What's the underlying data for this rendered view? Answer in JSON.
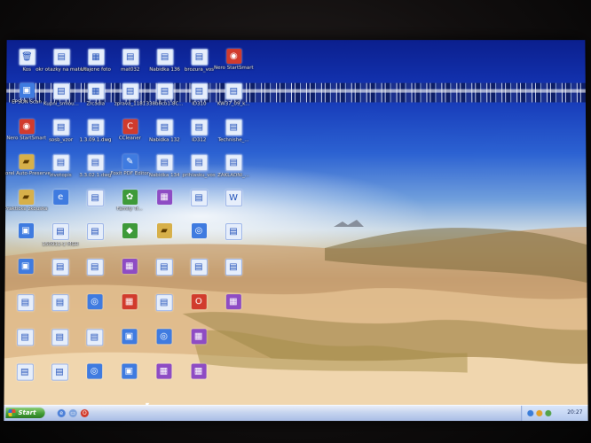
{
  "desktop": {
    "icons": [
      {
        "label": "Kos",
        "kind": "doc",
        "glyph": "🗑",
        "col": 0,
        "row": 0
      },
      {
        "label": "okr otazky na maturitu",
        "kind": "doc",
        "glyph": "▤",
        "col": 1,
        "row": 0
      },
      {
        "label": "Utajene foto",
        "kind": "doc",
        "glyph": "▦",
        "col": 2,
        "row": 0
      },
      {
        "label": "mat032",
        "kind": "doc",
        "glyph": "▤",
        "col": 3,
        "row": 0
      },
      {
        "label": "Nabidka 136",
        "kind": "doc",
        "glyph": "▤",
        "col": 4,
        "row": 0
      },
      {
        "label": "brozura_vos",
        "kind": "doc",
        "glyph": "▤",
        "col": 5,
        "row": 0
      },
      {
        "label": "Nero StartSmart",
        "kind": "red",
        "glyph": "◉",
        "col": 6,
        "row": 0
      },
      {
        "label": "EPSON Scan",
        "kind": "app",
        "glyph": "▣",
        "col": 0,
        "row": 1
      },
      {
        "label": "Kupni_smlou...",
        "kind": "doc",
        "glyph": "▤",
        "col": 1,
        "row": 1
      },
      {
        "label": "Zrcadla",
        "kind": "doc",
        "glyph": "▦",
        "col": 2,
        "row": 1
      },
      {
        "label": "zprava_1181",
        "kind": "doc",
        "glyph": "▤",
        "col": 3,
        "row": 1
      },
      {
        "label": "338b8cb1-8C...",
        "kind": "doc",
        "glyph": "▤",
        "col": 4,
        "row": 1
      },
      {
        "label": "ID310",
        "kind": "doc",
        "glyph": "▤",
        "col": 5,
        "row": 1
      },
      {
        "label": "KW37_09_k...",
        "kind": "doc",
        "glyph": "▤",
        "col": 6,
        "row": 1
      },
      {
        "label": "Nero StartSmart",
        "kind": "red",
        "glyph": "◉",
        "col": 0,
        "row": 2
      },
      {
        "label": "sosb_vzor",
        "kind": "doc",
        "glyph": "▤",
        "col": 1,
        "row": 2
      },
      {
        "label": "1.3.09.1.dwg",
        "kind": "doc",
        "glyph": "▤",
        "col": 2,
        "row": 2
      },
      {
        "label": "CCleaner",
        "kind": "red",
        "glyph": "C",
        "col": 3,
        "row": 2
      },
      {
        "label": "Nabidka 132",
        "kind": "doc",
        "glyph": "▤",
        "col": 4,
        "row": 2
      },
      {
        "label": "ID312",
        "kind": "doc",
        "glyph": "▤",
        "col": 5,
        "row": 2
      },
      {
        "label": "Technishe_...",
        "kind": "doc",
        "glyph": "▤",
        "col": 6,
        "row": 2
      },
      {
        "label": "Corel Auto-Preserve",
        "kind": "ylw",
        "glyph": "▰",
        "col": 0,
        "row": 3
      },
      {
        "label": "zivotopis",
        "kind": "doc",
        "glyph": "▤",
        "col": 1,
        "row": 3
      },
      {
        "label": "3.3.02.1.dwg",
        "kind": "doc",
        "glyph": "▤",
        "col": 2,
        "row": 3
      },
      {
        "label": "Foxit PDF Editor",
        "kind": "app",
        "glyph": "✎",
        "col": 3,
        "row": 3
      },
      {
        "label": "Nabidka 134",
        "kind": "doc",
        "glyph": "▤",
        "col": 4,
        "row": 3
      },
      {
        "label": "prihlasku_vos",
        "kind": "doc",
        "glyph": "▤",
        "col": 5,
        "row": 3
      },
      {
        "label": "ZAKLADNI_...",
        "kind": "doc",
        "glyph": "▤",
        "col": 6,
        "row": 3
      },
      {
        "label": "Prakticke zkouska",
        "kind": "ylw",
        "glyph": "▰",
        "col": 0,
        "row": 4
      },
      {
        "label": "",
        "kind": "app",
        "glyph": "e",
        "col": 1,
        "row": 4
      },
      {
        "label": "",
        "kind": "doc",
        "glyph": "▤",
        "col": 2,
        "row": 4
      },
      {
        "label": "Family Tr...",
        "kind": "grn",
        "glyph": "✿",
        "col": 3,
        "row": 4
      },
      {
        "label": "",
        "kind": "pur",
        "glyph": "▦",
        "col": 4,
        "row": 4
      },
      {
        "label": "",
        "kind": "doc",
        "glyph": "▤",
        "col": 5,
        "row": 4
      },
      {
        "label": "",
        "kind": "doc",
        "glyph": "W",
        "col": 6,
        "row": 4
      },
      {
        "label": "",
        "kind": "app",
        "glyph": "▣",
        "col": 0,
        "row": 5
      },
      {
        "label": "150911-1 MGR",
        "kind": "doc",
        "glyph": "▤",
        "col": 1,
        "row": 5
      },
      {
        "label": "",
        "kind": "doc",
        "glyph": "▤",
        "col": 2,
        "row": 5
      },
      {
        "label": "",
        "kind": "grn",
        "glyph": "◆",
        "col": 3,
        "row": 5
      },
      {
        "label": "",
        "kind": "ylw",
        "glyph": "▰",
        "col": 4,
        "row": 5
      },
      {
        "label": "",
        "kind": "app",
        "glyph": "◎",
        "col": 5,
        "row": 5
      },
      {
        "label": "",
        "kind": "doc",
        "glyph": "▤",
        "col": 6,
        "row": 5
      },
      {
        "label": "",
        "kind": "app",
        "glyph": "▣",
        "col": 0,
        "row": 6
      },
      {
        "label": "",
        "kind": "doc",
        "glyph": "▤",
        "col": 1,
        "row": 6
      },
      {
        "label": "",
        "kind": "doc",
        "glyph": "▤",
        "col": 2,
        "row": 6
      },
      {
        "label": "",
        "kind": "pur",
        "glyph": "▦",
        "col": 3,
        "row": 6
      },
      {
        "label": "",
        "kind": "doc",
        "glyph": "▤",
        "col": 4,
        "row": 6
      },
      {
        "label": "",
        "kind": "doc",
        "glyph": "▤",
        "col": 5,
        "row": 6
      },
      {
        "label": "",
        "kind": "doc",
        "glyph": "▤",
        "col": 6,
        "row": 6
      },
      {
        "label": "",
        "kind": "doc",
        "glyph": "▤",
        "col": 0,
        "row": 7
      },
      {
        "label": "",
        "kind": "doc",
        "glyph": "▤",
        "col": 1,
        "row": 7
      },
      {
        "label": "",
        "kind": "app",
        "glyph": "◎",
        "col": 2,
        "row": 7
      },
      {
        "label": "",
        "kind": "red",
        "glyph": "▦",
        "col": 3,
        "row": 7
      },
      {
        "label": "",
        "kind": "doc",
        "glyph": "▤",
        "col": 4,
        "row": 7
      },
      {
        "label": "",
        "kind": "red",
        "glyph": "O",
        "col": 5,
        "row": 7
      },
      {
        "label": "",
        "kind": "pur",
        "glyph": "▦",
        "col": 6,
        "row": 7
      },
      {
        "label": "",
        "kind": "doc",
        "glyph": "▤",
        "col": 0,
        "row": 8
      },
      {
        "label": "",
        "kind": "doc",
        "glyph": "▤",
        "col": 1,
        "row": 8
      },
      {
        "label": "",
        "kind": "doc",
        "glyph": "▤",
        "col": 2,
        "row": 8
      },
      {
        "label": "",
        "kind": "app",
        "glyph": "▣",
        "col": 3,
        "row": 8
      },
      {
        "label": "",
        "kind": "app",
        "glyph": "◎",
        "col": 4,
        "row": 8
      },
      {
        "label": "",
        "kind": "pur",
        "glyph": "▦",
        "col": 5,
        "row": 8
      },
      {
        "label": "",
        "kind": "doc",
        "glyph": "▤",
        "col": 0,
        "row": 9
      },
      {
        "label": "",
        "kind": "doc",
        "glyph": "▤",
        "col": 1,
        "row": 9
      },
      {
        "label": "",
        "kind": "app",
        "glyph": "◎",
        "col": 2,
        "row": 9
      },
      {
        "label": "",
        "kind": "app",
        "glyph": "▣",
        "col": 3,
        "row": 9
      },
      {
        "label": "",
        "kind": "pur",
        "glyph": "▦",
        "col": 4,
        "row": 9
      },
      {
        "label": "",
        "kind": "pur",
        "glyph": "▦",
        "col": 5,
        "row": 9
      }
    ]
  },
  "taskbar": {
    "start_label": "Start",
    "clock": "20:27"
  },
  "colors": {
    "sky_top": "#0b1f8e",
    "sand": "#e8c698",
    "start_green": "#3f9a33",
    "taskbar_blue": "#c6d4ef"
  }
}
